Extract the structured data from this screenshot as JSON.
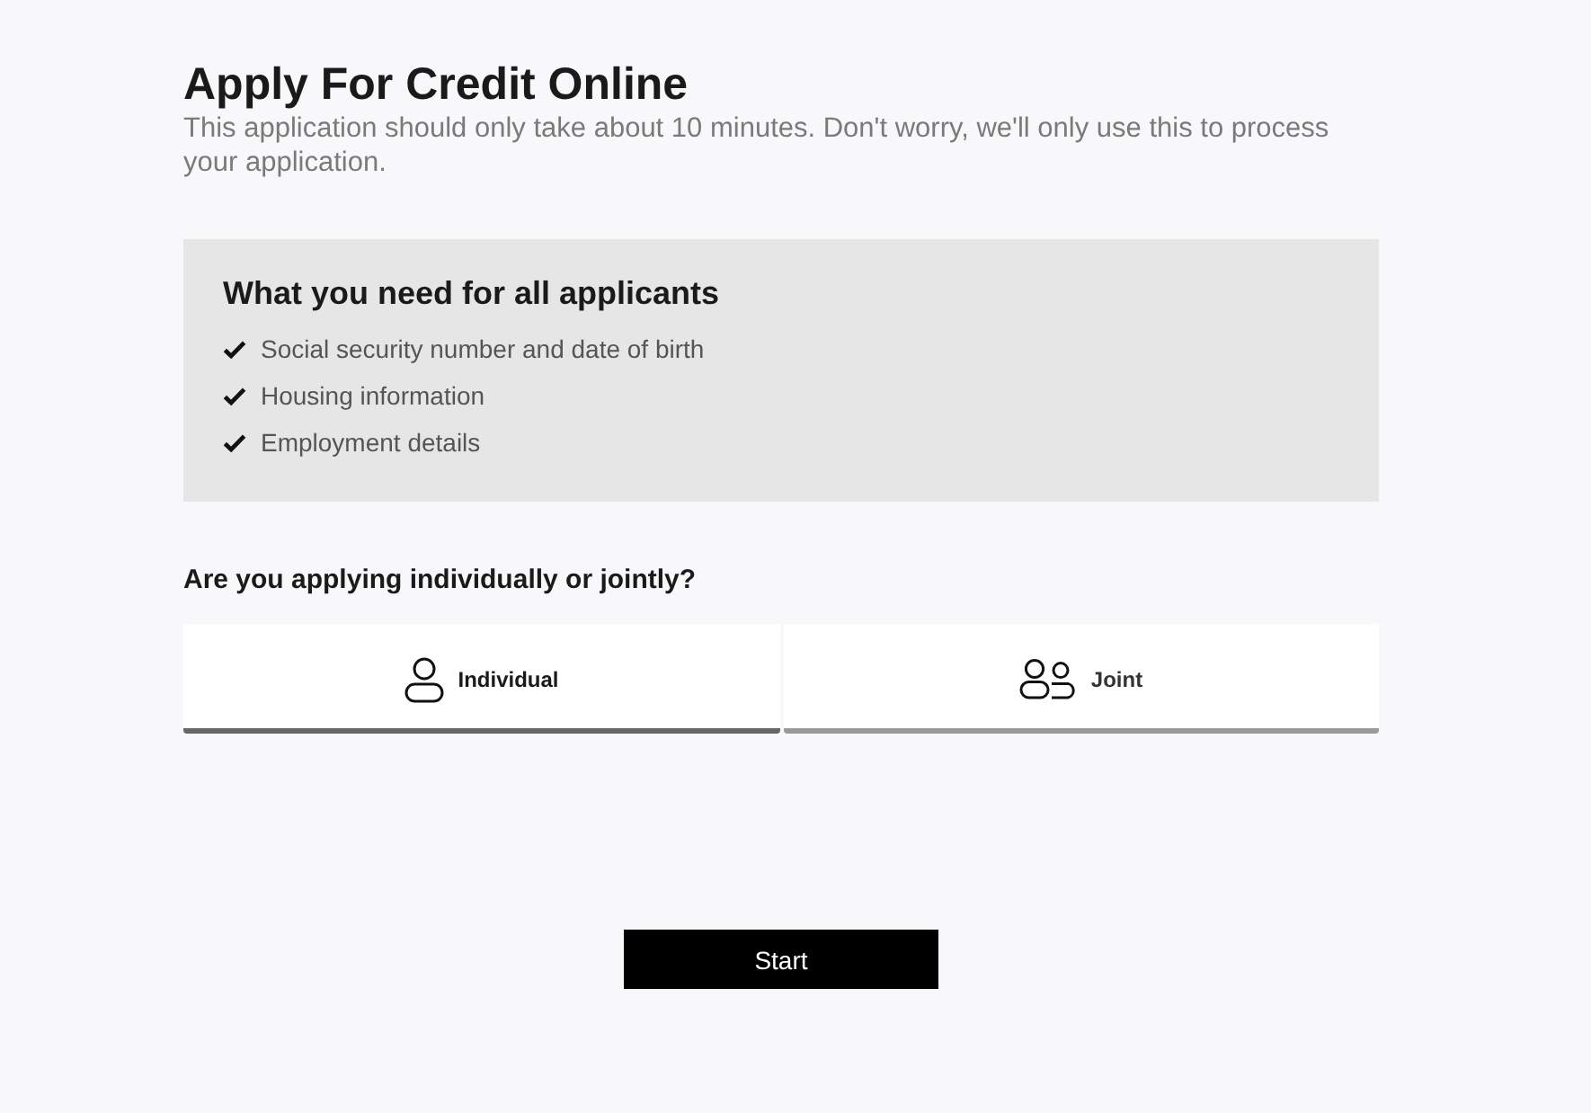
{
  "header": {
    "title": "Apply For Credit Online",
    "subtitle": "This application should only take about 10 minutes. Don't worry, we'll only use this to process your application."
  },
  "requirements": {
    "title": "What you need for all applicants",
    "items": [
      "Social security number and date of birth",
      "Housing information",
      "Employment details"
    ]
  },
  "question": "Are you applying individually or jointly?",
  "tabs": [
    {
      "label": "Individual",
      "kind": "person",
      "selected": true
    },
    {
      "label": "Joint",
      "kind": "people",
      "selected": false
    }
  ],
  "start_button": "Start"
}
